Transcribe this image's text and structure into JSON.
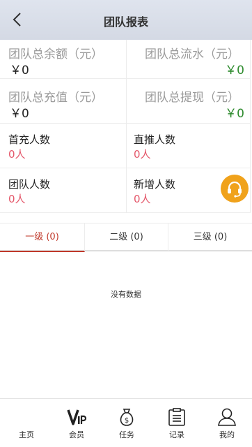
{
  "header": {
    "title": "团队报表"
  },
  "stats": {
    "total_balance_label": "团队总余额（元）",
    "total_balance_value": "￥0",
    "total_flow_label": "团队总流水（元）",
    "total_flow_value": "￥0",
    "total_recharge_label": "团队总充值（元）",
    "total_recharge_value": "￥0",
    "total_withdraw_label": "团队总提现（元）",
    "total_withdraw_value": "￥0",
    "first_recharge_label": "首充人数",
    "first_recharge_value": "0人",
    "direct_label": "直推人数",
    "direct_value": "0人",
    "team_size_label": "团队人数",
    "team_size_value": "0人",
    "new_members_label": "新增人数",
    "new_members_value": "0人"
  },
  "colors": {
    "accent": "#c0392b",
    "money_green": "#2e8b2e",
    "count_red": "#e4576a",
    "fab": "#f0a21b"
  },
  "tabs": [
    {
      "label": "一级 (0)",
      "active": true
    },
    {
      "label": "二级 (0)",
      "active": false
    },
    {
      "label": "三级 (0)",
      "active": false
    }
  ],
  "empty_text": "没有数据",
  "bottom_nav": [
    {
      "label": "主页",
      "icon": "home-icon"
    },
    {
      "label": "会员",
      "icon": "vip-icon"
    },
    {
      "label": "任务",
      "icon": "money-bag-icon"
    },
    {
      "label": "记录",
      "icon": "clipboard-icon"
    },
    {
      "label": "我的",
      "icon": "user-icon"
    }
  ]
}
